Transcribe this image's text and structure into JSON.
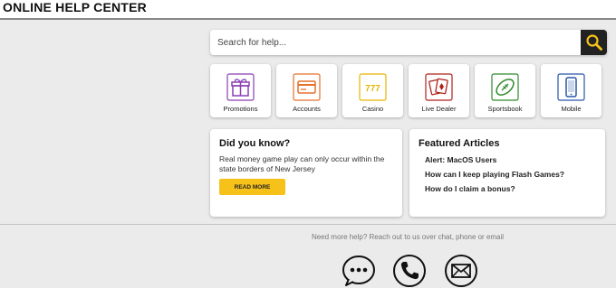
{
  "header": {
    "title": "ONLINE HELP CENTER"
  },
  "search": {
    "placeholder": "Search for help...",
    "button_icon": "search-icon"
  },
  "categories": [
    {
      "label": "Promotions",
      "icon": "gift-icon",
      "color": "#8a3fb5"
    },
    {
      "label": "Accounts",
      "icon": "credit-card-icon",
      "color": "#e5702a"
    },
    {
      "label": "Casino",
      "icon": "slot-777-icon",
      "color": "#e6b400"
    },
    {
      "label": "Live Dealer",
      "icon": "playing-cards-icon",
      "color": "#b0211b"
    },
    {
      "label": "Sportsbook",
      "icon": "football-icon",
      "color": "#2f8a2b"
    },
    {
      "label": "Mobile",
      "icon": "smartphone-icon",
      "color": "#2756a8"
    }
  ],
  "did_you_know": {
    "title": "Did you know?",
    "text": "Real money game play can only occur within the state borders of New Jersey",
    "button_label": "READ MORE"
  },
  "featured": {
    "title": "Featured Articles",
    "articles": [
      "Alert: MacOS Users",
      "How can I keep playing Flash Games?",
      "How do I claim a bonus?"
    ]
  },
  "footer": {
    "help_text": "Need more help? Reach out to us over chat, phone or email",
    "contact_icons": [
      "chat-icon",
      "phone-icon",
      "email-icon"
    ]
  },
  "colors": {
    "accent": "#f6c21a",
    "background": "#ebebeb",
    "search_button": "#222222"
  }
}
